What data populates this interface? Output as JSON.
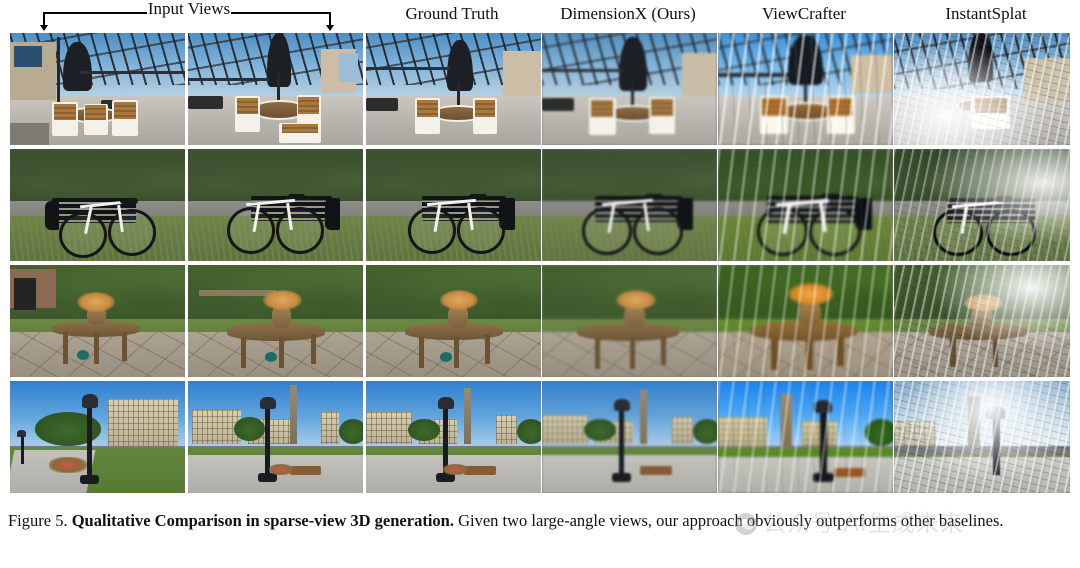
{
  "figure": {
    "caption_prefix": "Figure 5.",
    "caption_bold": "Qualitative Comparison in sparse-view 3D generation.",
    "caption_rest": "Given two large-angle views, our approach obviously outperforms other baselines."
  },
  "header": {
    "input_views_label": "Input Views",
    "columns": [
      {
        "id": "input-view-1",
        "label": "",
        "group": "Input Views"
      },
      {
        "id": "input-view-2",
        "label": "",
        "group": "Input Views"
      },
      {
        "id": "ground-truth",
        "label": "Ground Truth"
      },
      {
        "id": "dimensionx",
        "label": "DimensionX (Ours)"
      },
      {
        "id": "viewcrafter",
        "label": "ViewCrafter"
      },
      {
        "id": "instantsplat",
        "label": "InstantSplat"
      }
    ]
  },
  "grid": {
    "rows": [
      {
        "id": "row-patio",
        "scene": "Outdoor patio with black umbrella, round table and white wooden chairs under a steel canopy"
      },
      {
        "id": "row-bicycle",
        "scene": "White bicycle leaning on a black park bench beside a path and hedge"
      },
      {
        "id": "row-garden",
        "scene": "Round wooden garden table with a flower vase on a stone patio"
      },
      {
        "id": "row-plaza",
        "scene": "Campus plaza with lamppost, obelisk monument and beige buildings"
      }
    ],
    "cell_count": 24
  },
  "watermark": {
    "text": "公众号 AI生成未来",
    "logo": "wechat-logo"
  },
  "colors": {
    "page_background": "#ffffff",
    "text": "#111111",
    "watermark_text": "#9aa1a8",
    "cell_border": "#ffffff"
  }
}
